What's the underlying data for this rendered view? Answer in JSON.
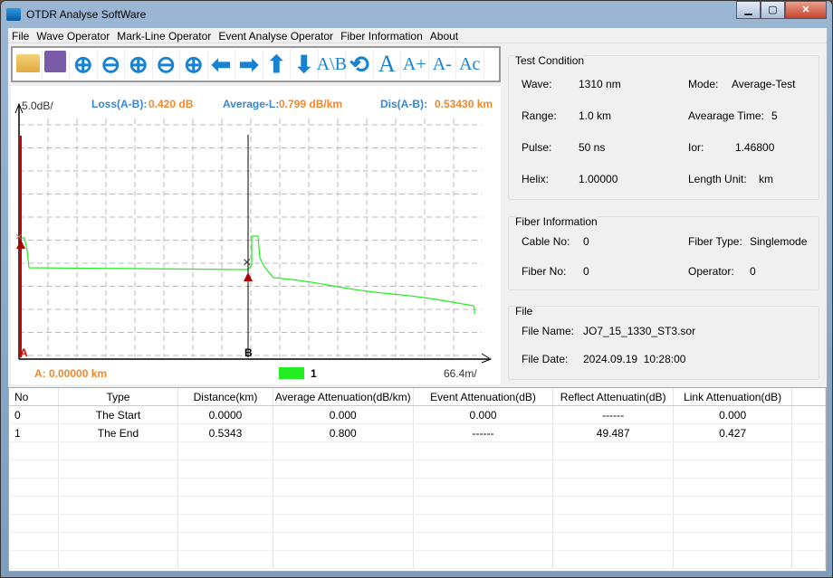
{
  "window": {
    "title": "OTDR Analyse SoftWare",
    "min": "▁",
    "max": "▢",
    "close": "✕"
  },
  "menu": [
    "File",
    "Wave Operator",
    "Mark-Line Operator",
    "Event Analyse Operator",
    "Fiber Information",
    "About"
  ],
  "toolbar": [
    {
      "icon": "open-folder-icon"
    },
    {
      "icon": "save-icon"
    },
    {
      "icon": "zoom-in-horizontal-icon"
    },
    {
      "icon": "zoom-out-horizontal-icon"
    },
    {
      "icon": "zoom-in-vertical-icon"
    },
    {
      "icon": "zoom-out-vertical-icon"
    },
    {
      "icon": "zoom-reset-icon"
    },
    {
      "icon": "arrow-left-icon"
    },
    {
      "icon": "arrow-right-icon"
    },
    {
      "icon": "arrow-up-icon"
    },
    {
      "icon": "arrow-down-icon"
    },
    {
      "icon": "ab-marker-icon",
      "text": "A\\B"
    },
    {
      "icon": "refresh-icon"
    },
    {
      "icon": "font-icon",
      "text": "A"
    },
    {
      "icon": "font-larger-icon",
      "text": "A+"
    },
    {
      "icon": "font-smaller-icon",
      "text": "A-"
    },
    {
      "icon": "font-color-icon",
      "text": "Ac"
    }
  ],
  "chart": {
    "y_scale": "5.0dB/",
    "loss_label": "Loss(A-B):",
    "loss_value": "0.420 dB",
    "avg_label": "Average-L:",
    "avg_value": "0.799 dB/km",
    "dis_label": "Dis(A-B):",
    "dis_value": "0.53430 km",
    "marker_a": "A",
    "marker_b": "B",
    "a_position": "A: 0.00000 km",
    "legend": "1",
    "x_scale": "66.4m/",
    "trace_color": "#22ee22"
  },
  "test_condition": {
    "title": "Test Condition",
    "wave_label": "Wave:",
    "wave": "1310 nm",
    "mode_label": "Mode:",
    "mode": "Average-Test",
    "range_label": "Range:",
    "range": "1.0 km",
    "avg_time_label": "Avearage Time:",
    "avg_time": "5",
    "pulse_label": "Pulse:",
    "pulse": "50 ns",
    "ior_label": "Ior:",
    "ior": "1.46800",
    "helix_label": "Helix:",
    "helix": "1.00000",
    "unit_label": "Length Unit:",
    "unit": "km"
  },
  "fiber_info": {
    "title": "Fiber Information",
    "cable_label": "Cable No:",
    "cable": "0",
    "type_label": "Fiber Type:",
    "type": "Singlemode",
    "fiber_label": "Fiber No:",
    "fiber": "0",
    "operator_label": "Operator:",
    "operator": "0"
  },
  "file": {
    "title": "File",
    "name_label": "File Name:",
    "name": "JO7_15_1330_ST3.sor",
    "date_label": "File Date:",
    "date": "2024.09.19  10:28:00"
  },
  "table": {
    "headers": [
      "No",
      "Type",
      "Distance(km)",
      "Average Attenuation(dB/km)",
      "Event Attenuation(dB)",
      "Reflect Attenuatin(dB)",
      "Link Attenuation(dB)"
    ],
    "rows": [
      [
        "0",
        "The Start",
        "0.0000",
        "0.000",
        "0.000",
        "------",
        "0.000"
      ],
      [
        "1",
        "The End",
        "0.5343",
        "0.800",
        "------",
        "49.487",
        "0.427"
      ]
    ]
  }
}
